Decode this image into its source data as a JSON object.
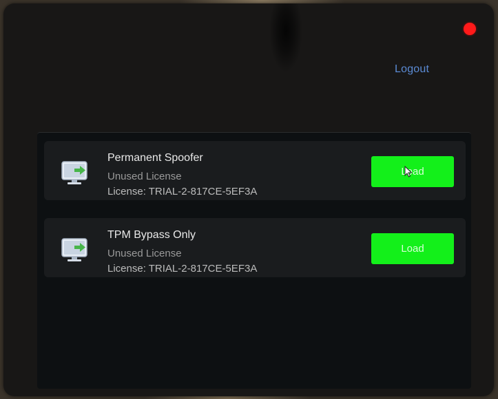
{
  "header": {
    "logout_label": "Logout"
  },
  "licenses": [
    {
      "title": "Permanent Spoofer",
      "status": "Unused License",
      "license": "License: TRIAL-2-817CE-5EF3A",
      "button_label": "Load",
      "icon": "monitor-arrow-icon"
    },
    {
      "title": "TPM Bypass Only",
      "status": "Unused License",
      "license": "License: TRIAL-2-817CE-5EF3A",
      "button_label": "Load",
      "icon": "monitor-arrow-icon"
    }
  ],
  "colors": {
    "window_bg": "#181716",
    "panel_bg": "#0d1012",
    "card_bg": "#1a1c1e",
    "accent_green": "#13f01a",
    "close_red": "#ff1a1a",
    "link_blue": "#5b8bd4"
  }
}
